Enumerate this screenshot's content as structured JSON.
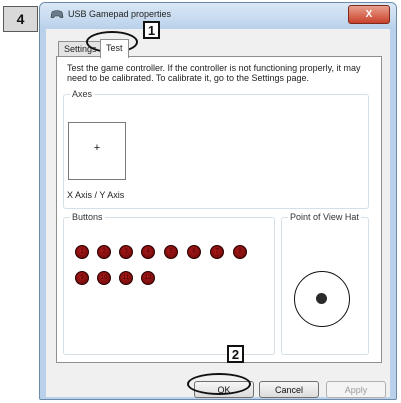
{
  "steps": {
    "outer": "4",
    "tab": "1",
    "ok": "2"
  },
  "window": {
    "title": "USB Gamepad properties",
    "close_symbol": "X",
    "icon": "gamepad-icon"
  },
  "tabs": [
    {
      "label": "Settings",
      "active": false
    },
    {
      "label": "Test",
      "active": true
    }
  ],
  "description": "Test the game controller.  If the controller is not functioning properly, it may need to be calibrated.  To calibrate it, go to the Settings page.",
  "axes": {
    "group_label": "Axes",
    "crosshair": "+",
    "caption": "X Axis / Y Axis"
  },
  "buttons_group": {
    "label": "Buttons",
    "buttons": [
      "1",
      "2",
      "3",
      "4",
      "5",
      "6",
      "7",
      "8",
      "9",
      "10",
      "11",
      "12"
    ]
  },
  "pov": {
    "label": "Point of View Hat"
  },
  "dialog_buttons": {
    "ok": "OK",
    "cancel": "Cancel",
    "apply": "Apply"
  },
  "colors": {
    "button_indicator": "#8b0d0d",
    "window_frame": "#b9d1ea",
    "close_button": "#c9412a"
  }
}
